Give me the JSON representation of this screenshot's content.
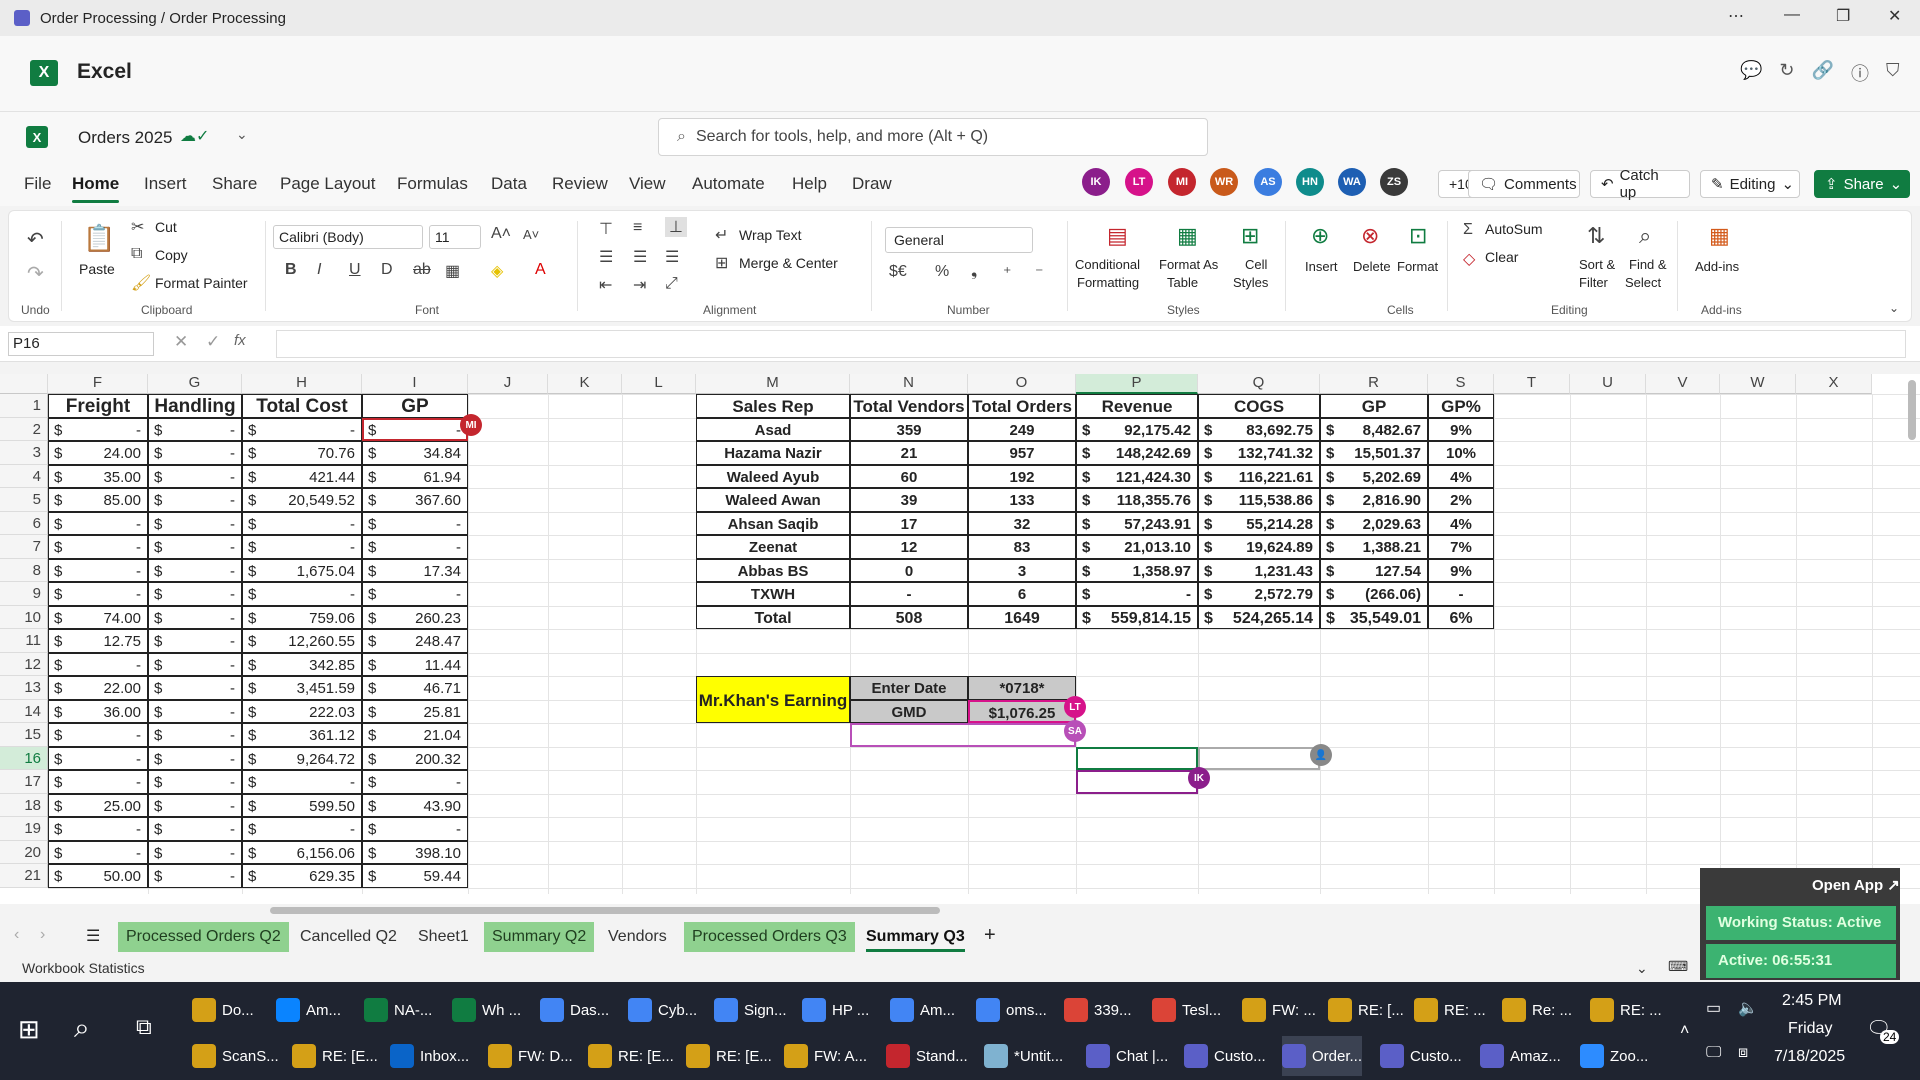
{
  "window": {
    "title": "Order Processing / Order Processing"
  },
  "app": {
    "name": "Excel",
    "doc_name": "Orders 2025"
  },
  "search": {
    "placeholder": "Search for tools, help, and more (Alt + Q)"
  },
  "menu_tabs": [
    "File",
    "Home",
    "Insert",
    "Share",
    "Page Layout",
    "Formulas",
    "Data",
    "Review",
    "View",
    "Automate",
    "Help",
    "Draw"
  ],
  "collaborators": [
    {
      "initials": "IK",
      "color": "#8b1e8b"
    },
    {
      "initials": "LT",
      "color": "#d6128a"
    },
    {
      "initials": "MI",
      "color": "#c4262e"
    },
    {
      "initials": "WR",
      "color": "#c95a1b"
    },
    {
      "initials": "AS",
      "color": "#3b7de0"
    },
    {
      "initials": "HN",
      "color": "#0f8c8c"
    },
    {
      "initials": "WA",
      "color": "#1e5fb3"
    },
    {
      "initials": "ZS",
      "color": "#3a3a3a"
    }
  ],
  "collab_more": "+10",
  "header_buttons": {
    "comments": "Comments",
    "catchup": "Catch up",
    "editing": "Editing",
    "share": "Share"
  },
  "ribbon": {
    "undo_group": "Undo",
    "clipboard": {
      "paste": "Paste",
      "cut": "Cut",
      "copy": "Copy",
      "format_painter": "Format Painter",
      "group": "Clipboard"
    },
    "font": {
      "name": "Calibri (Body)",
      "size": "11",
      "group": "Font"
    },
    "alignment": {
      "wrap": "Wrap Text",
      "merge": "Merge & Center",
      "group": "Alignment"
    },
    "number": {
      "format": "General",
      "group": "Number"
    },
    "styles": {
      "cond1": "Conditional",
      "cond2": "Formatting",
      "fat1": "Format As",
      "fat2": "Table",
      "cs1": "Cell",
      "cs2": "Styles",
      "group": "Styles"
    },
    "cells": {
      "insert": "Insert",
      "delete": "Delete",
      "format": "Format",
      "group": "Cells"
    },
    "editing": {
      "autosum": "AutoSum",
      "clear": "Clear",
      "sort1": "Sort &",
      "sort2": "Filter",
      "find1": "Find &",
      "find2": "Select",
      "group": "Editing"
    },
    "addins": {
      "label": "Add-ins",
      "group": "Add-ins"
    }
  },
  "namebox": "P16",
  "columns": [
    "F",
    "G",
    "H",
    "I",
    "J",
    "K",
    "L",
    "M",
    "N",
    "O",
    "P",
    "Q",
    "R",
    "S",
    "T",
    "U",
    "V",
    "W",
    "X"
  ],
  "rows": [
    "1",
    "2",
    "3",
    "4",
    "5",
    "6",
    "7",
    "8",
    "9",
    "10",
    "11",
    "12",
    "13",
    "14",
    "15",
    "16",
    "17",
    "18",
    "19",
    "20",
    "21"
  ],
  "left_table": {
    "headers": [
      "Freight",
      "Handling",
      "Total Cost",
      "GP"
    ],
    "rows": [
      [
        "-",
        "-",
        "-",
        "-"
      ],
      [
        "24.00",
        "-",
        "70.76",
        "34.84"
      ],
      [
        "35.00",
        "-",
        "421.44",
        "61.94"
      ],
      [
        "85.00",
        "-",
        "20,549.52",
        "367.60"
      ],
      [
        "-",
        "-",
        "-",
        "-"
      ],
      [
        "-",
        "-",
        "-",
        "-"
      ],
      [
        "-",
        "-",
        "1,675.04",
        "17.34"
      ],
      [
        "-",
        "-",
        "-",
        "-"
      ],
      [
        "74.00",
        "-",
        "759.06",
        "260.23"
      ],
      [
        "12.75",
        "-",
        "12,260.55",
        "248.47"
      ],
      [
        "-",
        "-",
        "342.85",
        "11.44"
      ],
      [
        "22.00",
        "-",
        "3,451.59",
        "46.71"
      ],
      [
        "36.00",
        "-",
        "222.03",
        "25.81"
      ],
      [
        "-",
        "-",
        "361.12",
        "21.04"
      ],
      [
        "-",
        "-",
        "9,264.72",
        "200.32"
      ],
      [
        "-",
        "-",
        "-",
        "-"
      ],
      [
        "25.00",
        "-",
        "599.50",
        "43.90"
      ],
      [
        "-",
        "-",
        "-",
        "-"
      ],
      [
        "-",
        "-",
        "6,156.06",
        "398.10"
      ],
      [
        "50.00",
        "-",
        "629.35",
        "59.44"
      ]
    ]
  },
  "summary": {
    "headers": [
      "Sales Rep",
      "Total Vendors",
      "Total Orders",
      "Revenue",
      "COGS",
      "GP",
      "GP%"
    ],
    "rows": [
      [
        "Asad",
        "359",
        "249",
        "92,175.42",
        "83,692.75",
        "8,482.67",
        "9%"
      ],
      [
        "Hazama Nazir",
        "21",
        "957",
        "148,242.69",
        "132,741.32",
        "15,501.37",
        "10%"
      ],
      [
        "Waleed Ayub",
        "60",
        "192",
        "121,424.30",
        "116,221.61",
        "5,202.69",
        "4%"
      ],
      [
        "Waleed Awan",
        "39",
        "133",
        "118,355.76",
        "115,538.86",
        "2,816.90",
        "2%"
      ],
      [
        "Ahsan Saqib",
        "17",
        "32",
        "57,243.91",
        "55,214.28",
        "2,029.63",
        "4%"
      ],
      [
        "Zeenat",
        "12",
        "83",
        "21,013.10",
        "19,624.89",
        "1,388.21",
        "7%"
      ],
      [
        "Abbas BS",
        "0",
        "3",
        "1,358.97",
        "1,231.43",
        "127.54",
        "9%"
      ],
      [
        "TXWH",
        "-",
        "6",
        "-",
        "2,572.79",
        "(266.06)",
        "-"
      ]
    ],
    "total": [
      "Total",
      "508",
      "1649",
      "559,814.15",
      "524,265.14",
      "35,549.01",
      "6%"
    ]
  },
  "earning": {
    "label": "Mr.Khan's Earning",
    "enter_date": "Enter Date",
    "date_val": "*0718*",
    "gmd": "GMD",
    "gmd_val": "$1,076.25"
  },
  "dollar": "$",
  "sheet_tabs": [
    {
      "name": "Processed Orders Q2",
      "style": "green"
    },
    {
      "name": "Cancelled Q2",
      "style": ""
    },
    {
      "name": "Sheet1",
      "style": ""
    },
    {
      "name": "Summary Q2",
      "style": "green"
    },
    {
      "name": "Vendors",
      "style": ""
    },
    {
      "name": "Processed Orders Q3",
      "style": "green"
    },
    {
      "name": "Summary Q3",
      "style": "cur"
    }
  ],
  "status": {
    "left": "Workbook Statistics"
  },
  "overlay": {
    "open_app": "Open App ↗",
    "working": "Working Status: Active",
    "active": "Active: 06:55:31"
  },
  "taskbar": {
    "row1": [
      "Do...",
      "Am...",
      "NA-...",
      "Wh ...",
      "Das...",
      "Cyb...",
      "Sign...",
      "HP ...",
      "Am...",
      "oms...",
      "339...",
      "Tesl...",
      "FW: ...",
      "RE: [...",
      "RE: ...",
      "Re: ...",
      "RE: ..."
    ],
    "row2": [
      "ScanS...",
      "RE: [E...",
      "Inbox...",
      "FW: D...",
      "RE: [E...",
      "RE: [E...",
      "FW: A...",
      "Stand...",
      "*Untit...",
      "Chat |...",
      "Custo...",
      "Order...",
      "Custo...",
      "Amaz...",
      "Zoo..."
    ],
    "time": "2:45 PM",
    "day": "Friday",
    "date": "7/18/2025",
    "notif": "24"
  }
}
